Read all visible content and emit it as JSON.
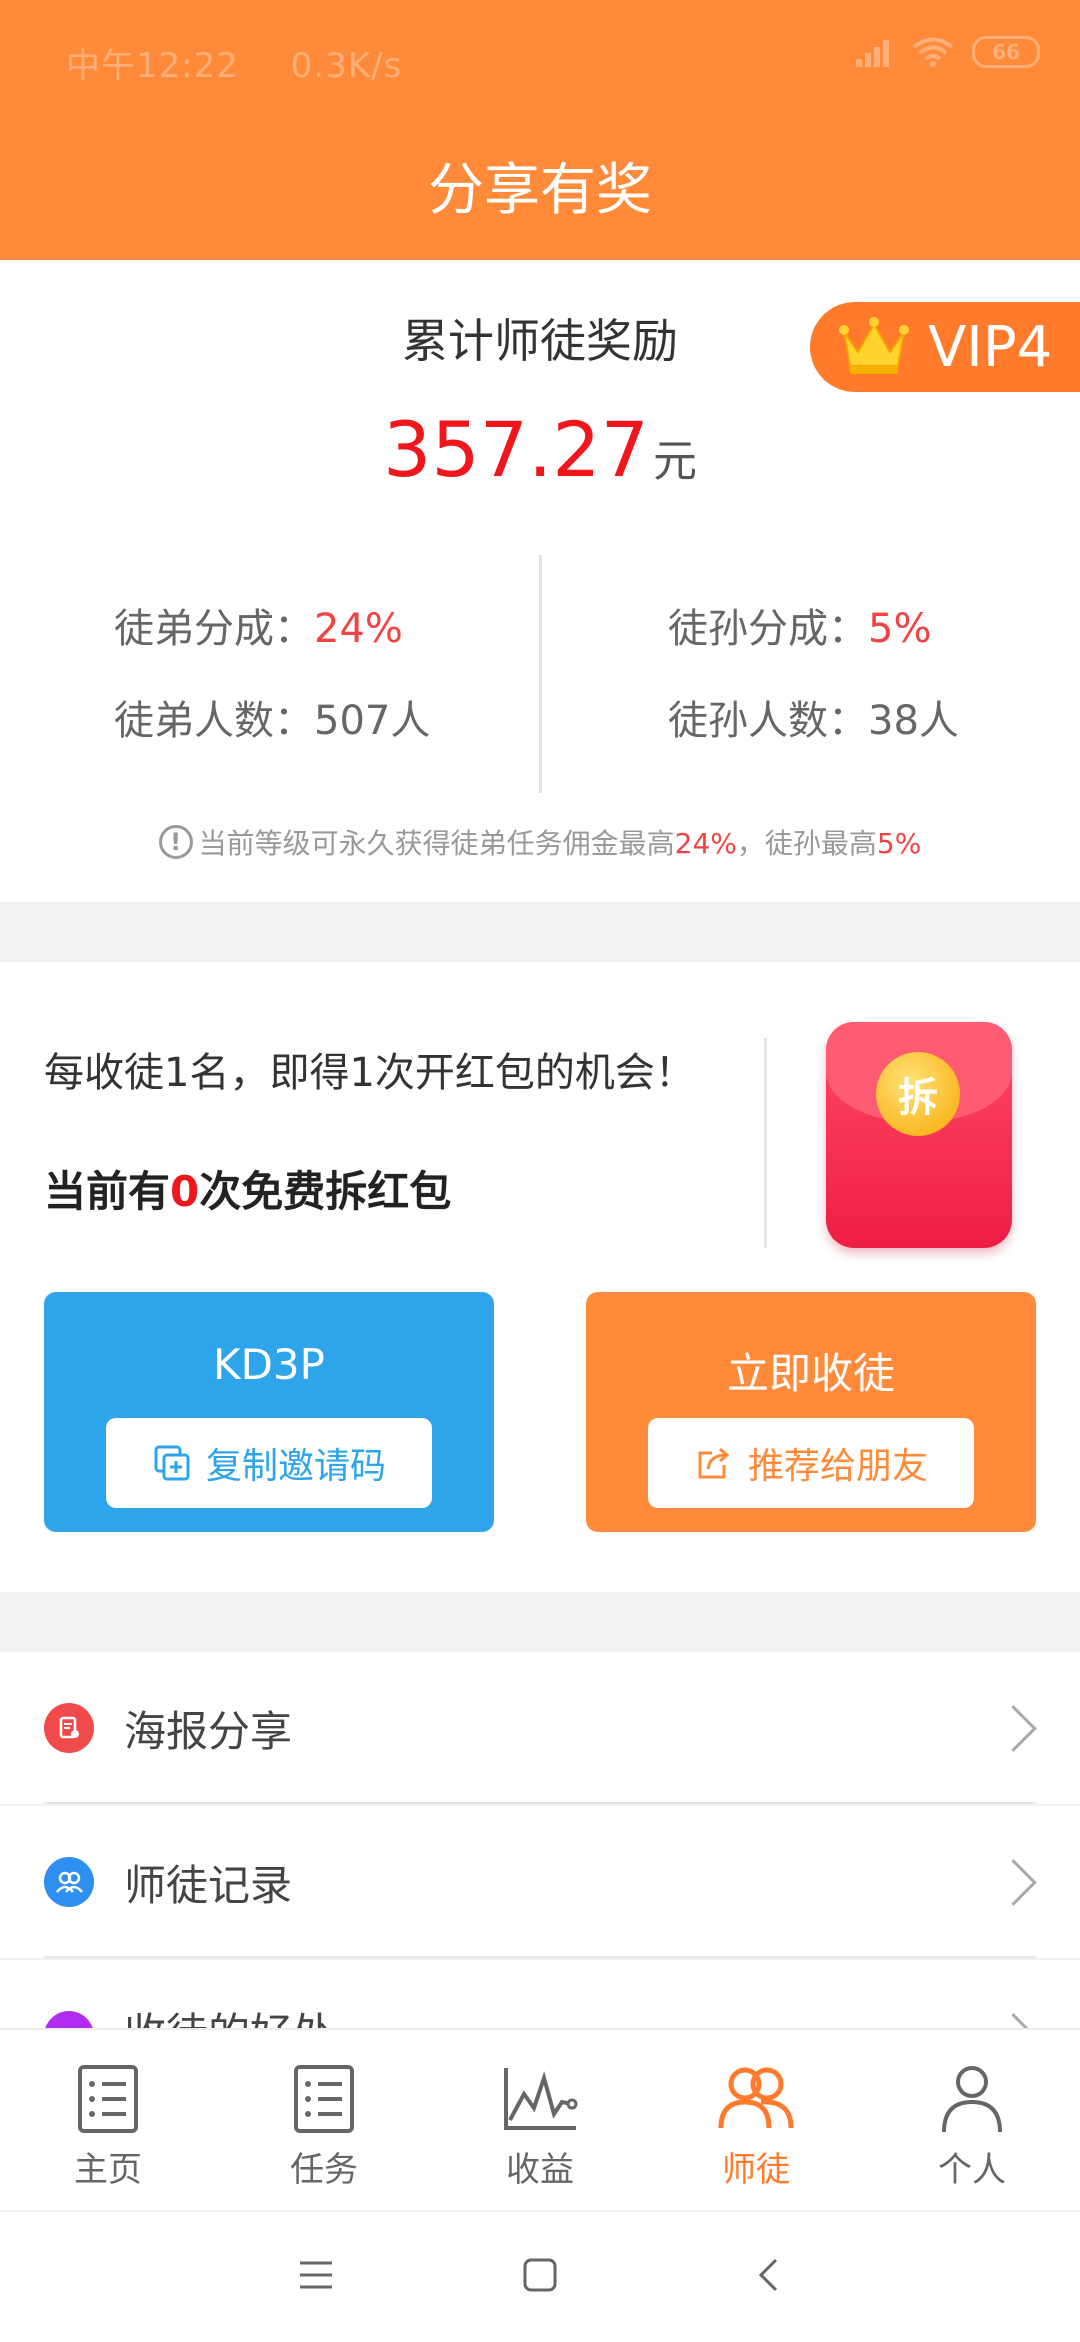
{
  "status_bar": {
    "time": "中午12:22",
    "speed": "0.3K/s",
    "battery": "66"
  },
  "header": {
    "title": "分享有奖"
  },
  "summary": {
    "title": "累计师徒奖励",
    "amount": "357.27",
    "unit": "元",
    "vip": "VIP4",
    "left": {
      "share_label": "徒弟分成：",
      "share_value": "24%",
      "count_label": "徒弟人数：",
      "count_value": "507人"
    },
    "right": {
      "share_label": "徒孙分成：",
      "share_value": "5%",
      "count_label": "徒孙人数：",
      "count_value": "38人"
    },
    "tip_prefix": "当前等级可永久获得徒弟任务佣金最高",
    "tip_value1": "24%",
    "tip_middle": "，徒孙最高",
    "tip_value2": "5%"
  },
  "invite": {
    "line1": "每收徒1名，即得1次开红包的机会！",
    "line2_prefix": "当前有",
    "line2_count": "0",
    "line2_suffix": "次免费拆红包",
    "packet_char": "拆",
    "code": "KD3P",
    "copy_label": "复制邀请码",
    "recruit_title": "立即收徒",
    "recommend_label": "推荐给朋友"
  },
  "menu": [
    {
      "label": "海报分享",
      "icon": "poster-icon",
      "color": "#f04a4a"
    },
    {
      "label": "师徒记录",
      "icon": "users-icon",
      "color": "#2d8ff0"
    },
    {
      "label": "收徒的好处",
      "icon": "benefit-icon",
      "color": "#b02cf0"
    }
  ],
  "tabs": [
    {
      "label": "主页",
      "icon": "home-list-icon",
      "active": false
    },
    {
      "label": "任务",
      "icon": "task-list-icon",
      "active": false
    },
    {
      "label": "收益",
      "icon": "chart-icon",
      "active": false
    },
    {
      "label": "师徒",
      "icon": "mentor-icon",
      "active": true
    },
    {
      "label": "个人",
      "icon": "person-icon",
      "active": false
    }
  ],
  "colors": {
    "brand": "#ff8a3a",
    "blue": "#2ea5ea",
    "red": "#f0171c"
  }
}
